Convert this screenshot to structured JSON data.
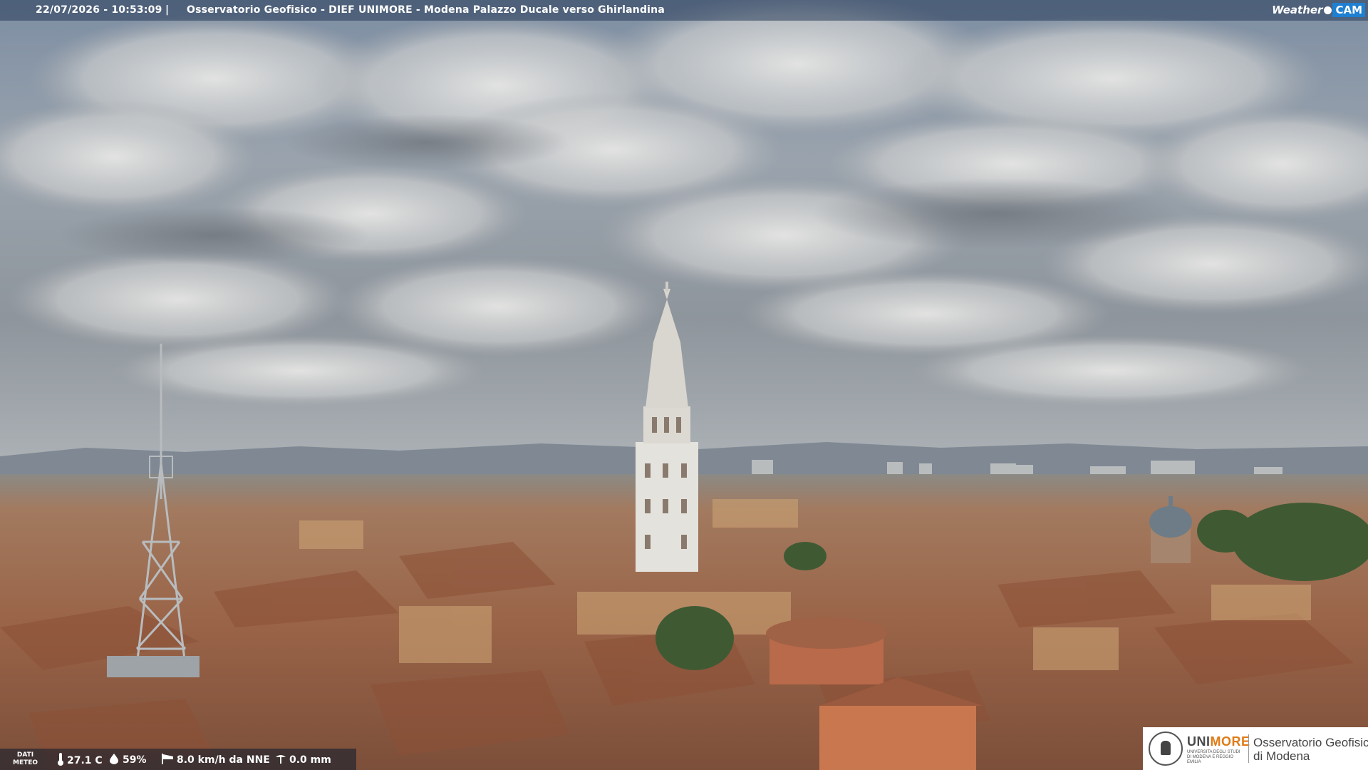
{
  "header": {
    "timestamp": "22/07/2026 - 10:53:09",
    "separator": "|",
    "title": "Osservatorio Geofisico - DIEF UNIMORE - Modena Palazzo Ducale verso Ghirlandina"
  },
  "brand": {
    "weather": "Weather",
    "cam": "CAM"
  },
  "weather": {
    "label_line1": "DATI",
    "label_line2": "METEO",
    "temperature": "27.1 C",
    "humidity": "59%",
    "wind": "8.0 km/h da NNE",
    "rain": "0.0 mm",
    "icons": [
      "thermometer-icon",
      "humidity-drop-icon",
      "wind-sock-icon",
      "rain-gauge-icon"
    ]
  },
  "logo": {
    "university_prefix": "UNI",
    "university_suffix": "MORE",
    "university_caption": "UNIVERSITA DEGLI STUDI DI MODENA E REGGIO EMILIA",
    "observatory_line1": "Osservatorio Geofisico",
    "observatory_line2": "di Modena"
  },
  "colors": {
    "accent_orange": "#e07b17",
    "brand_blue": "#1f7fd1",
    "sky": "#8a939c",
    "roofs": "#a0654a"
  }
}
